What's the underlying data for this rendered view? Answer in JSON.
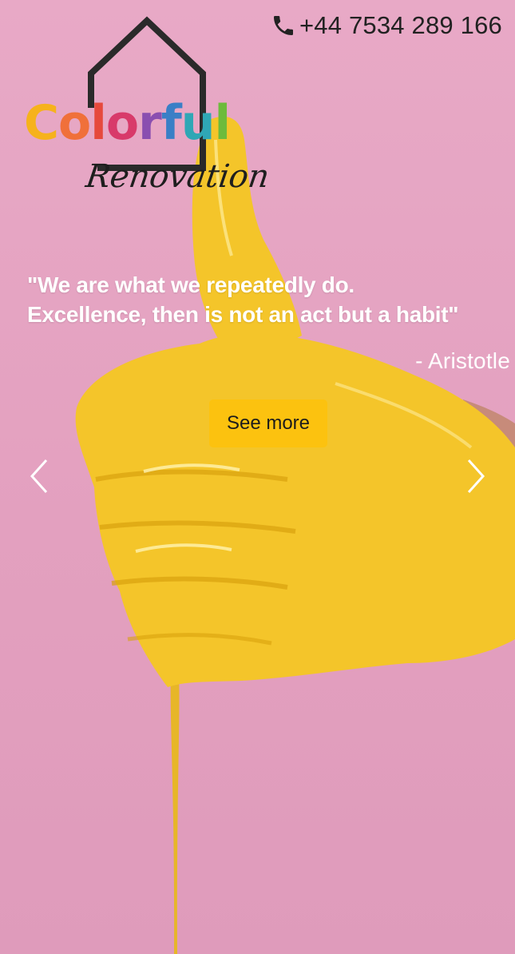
{
  "header": {
    "phone_icon": "phone-icon",
    "phone": "+44 7534 289 166"
  },
  "logo": {
    "icon": "house-outline-icon",
    "word_letters": [
      {
        "ch": "C",
        "color": "#f6b21c"
      },
      {
        "ch": "o",
        "color": "#f0703a"
      },
      {
        "ch": "l",
        "color": "#e6493c"
      },
      {
        "ch": "o",
        "color": "#d83a6a"
      },
      {
        "ch": "r",
        "color": "#8a4fb0"
      },
      {
        "ch": "f",
        "color": "#3a7fc6"
      },
      {
        "ch": "u",
        "color": "#2fa7b5"
      },
      {
        "ch": "l",
        "color": "#6dbb3c"
      }
    ],
    "subtitle": "Renovation"
  },
  "hero": {
    "quote_line1": "\"We are what we repeatedly do.",
    "quote_line2": "Excellence, then is not an act but a habit\"",
    "author": "- Aristotle",
    "cta_label": "See more",
    "prev_icon": "chevron-left-icon",
    "next_icon": "chevron-right-icon"
  },
  "colors": {
    "background": "#e4a3c1",
    "cta": "#fcc20f",
    "glove": "#f4c52a"
  }
}
